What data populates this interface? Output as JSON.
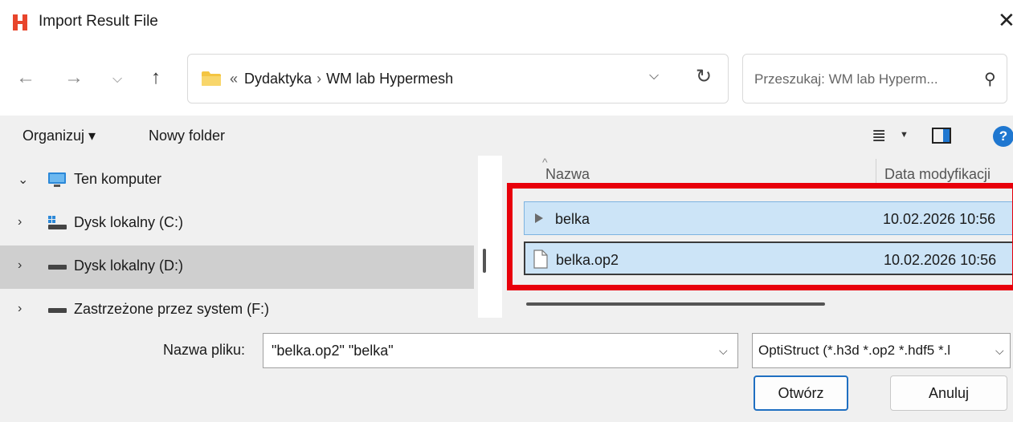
{
  "window": {
    "title": "Import Result File",
    "close_glyph": "✕",
    "logo_color": "#e8452c"
  },
  "nav": {
    "back_glyph": "←",
    "forward_glyph": "→",
    "recent_glyph": "⌵",
    "up_glyph": "↑",
    "breadcrumb_prefix": "«",
    "breadcrumb": [
      "Dydaktyka",
      "WM lab Hypermesh"
    ],
    "breadcrumb_sep": "›",
    "address_dropdown_glyph": "⌵",
    "refresh_glyph": "↻",
    "search_placeholder": "Przeszukaj: WM lab Hyperm...",
    "search_glyph": "⚲"
  },
  "toolbar": {
    "organize_label": "Organizuj ▾",
    "new_folder_label": "Nowy folder",
    "view_glyph": "≣",
    "view_caret": "▼",
    "help_glyph": "?"
  },
  "tree": [
    {
      "chevron": "⌄",
      "label": "Ten komputer",
      "icon": "computer-icon"
    },
    {
      "chevron": "›",
      "label": "Dysk lokalny (C:)",
      "icon": "windows-drive-icon"
    },
    {
      "chevron": "›",
      "label": "Dysk lokalny (D:)",
      "icon": "drive-icon",
      "selected": true
    },
    {
      "chevron": "›",
      "label": "Zastrzeżone przez system (F:)",
      "icon": "drive-icon"
    }
  ],
  "file_list": {
    "sort_glyph": "^",
    "columns": [
      "Nazwa",
      "Data modyfikacji"
    ],
    "files": [
      {
        "name": "belka",
        "modified": "10.02.2026 10:56",
        "icon": "play-file-icon"
      },
      {
        "name": "belka.op2",
        "modified": "10.02.2026 10:56",
        "icon": "document-file-icon"
      }
    ],
    "highlight_color": "#e8000b"
  },
  "footer": {
    "filename_label": "Nazwa pliku:",
    "filename_value": "\"belka.op2\" \"belka\"",
    "filename_dropdown_glyph": "⌵",
    "filetype_value": "OptiStruct (*.h3d *.op2 *.hdf5 *.l",
    "filetype_dropdown_glyph": "⌵",
    "open_label": "Otwórz",
    "cancel_label": "Anuluj"
  }
}
